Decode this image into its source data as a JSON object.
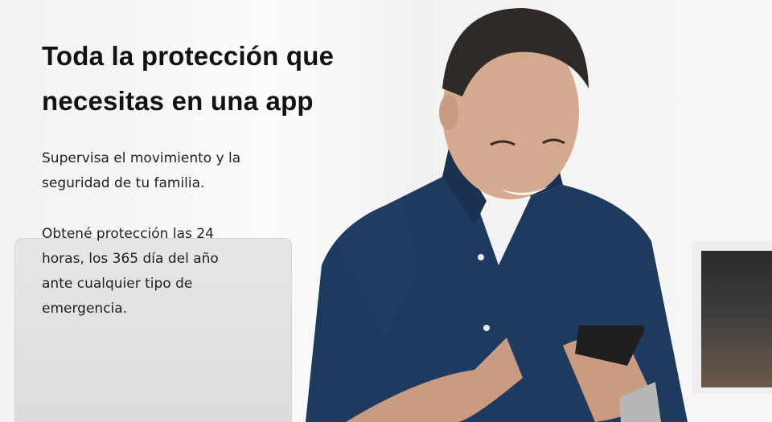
{
  "hero": {
    "headline": "Toda la protección que necesitas en una app",
    "paragraph1": "Supervisa el movimiento y la seguridad de tu familia.",
    "paragraph2": "Obtené protección las 24 horas, los 365 día del año ante cualquier tipo de emergencia."
  },
  "colors": {
    "background": "#f4f4f4",
    "text": "#121212",
    "shirt": "#1f3a5f"
  },
  "image": {
    "subject": "man-smiling-using-smartphone-photo"
  }
}
